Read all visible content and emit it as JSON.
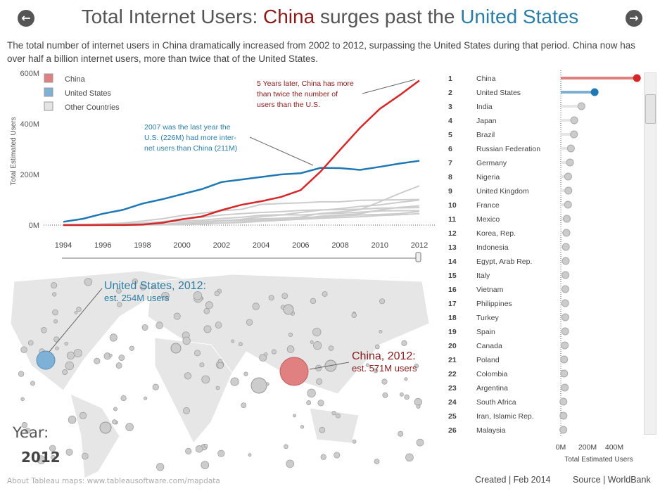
{
  "header": {
    "title_prefix": "Total Internet Users: ",
    "title_china": "China",
    "title_mid": " surges past the ",
    "title_us": "United States",
    "back_icon": "arrow-left-icon",
    "forward_icon": "arrow-right-icon"
  },
  "description": "The total number of internet users in China dramatically increased from 2002 to 2012, surpassing the United States during that period. China now has over half a billion internet users, more than twice that of the United States.",
  "colors": {
    "china": "#d62728",
    "china_light": "#e08080",
    "us": "#1f77b4",
    "us_light": "#7fb0d6",
    "other": "#cccccc",
    "us_text": "#2a7ea6",
    "china_text": "#8b1a1a"
  },
  "chart_data": [
    {
      "type": "line",
      "ylabel": "Total Estimated Users",
      "ylim": [
        0,
        600
      ],
      "y_unit": "M",
      "yticks": [
        "0M",
        "200M",
        "400M",
        "600M"
      ],
      "x": [
        1994,
        1995,
        1996,
        1997,
        1998,
        1999,
        2000,
        2001,
        2002,
        2003,
        2004,
        2005,
        2006,
        2007,
        2008,
        2009,
        2010,
        2011,
        2012
      ],
      "xticks": [
        "1994",
        "1996",
        "1998",
        "2000",
        "2002",
        "2004",
        "2006",
        "2008",
        "2010",
        "2012"
      ],
      "legend": [
        "China",
        "United States",
        "Other Countries"
      ],
      "legend_position": "top-left",
      "series": [
        {
          "name": "China",
          "values": [
            0,
            0,
            0.2,
            0.4,
            2,
            9,
            23,
            34,
            59,
            80,
            94,
            111,
            138,
            211,
            298,
            384,
            459,
            513,
            571
          ]
        },
        {
          "name": "United States",
          "values": [
            13,
            25,
            45,
            60,
            85,
            102,
            122,
            142,
            170,
            180,
            190,
            200,
            205,
            226,
            225,
            218,
            230,
            243,
            254
          ]
        },
        {
          "name": "Other Countries",
          "lines": [
            [
              0,
              0,
              0.1,
              0.3,
              1,
              3,
              5,
              7,
              17,
              18,
              22,
              27,
              32,
              46,
              52,
              61,
              92,
              125,
              155
            ],
            [
              2,
              3,
              5,
              8,
              16,
              25,
              38,
              47,
              57,
              62,
              82,
              85,
              88,
              92,
              92,
              98,
              99,
              100,
              101
            ],
            [
              0,
              0,
              0.2,
              0.5,
              1.5,
              2.5,
              5,
              11,
              16,
              23,
              33,
              40,
              50,
              59,
              65,
              74,
              80,
              90,
              99
            ],
            [
              0,
              0.1,
              0.3,
              0.6,
              1.2,
              2,
              3,
              4,
              9,
              12,
              18,
              22,
              25,
              35,
              40,
              45,
              60,
              70,
              76
            ],
            [
              1,
              2,
              3,
              5,
              8,
              14,
              24,
              31,
              40,
              45,
              50,
              53,
              58,
              60,
              61,
              63,
              67,
              68,
              69
            ],
            [
              1,
              2,
              3,
              5,
              8,
              12,
              16,
              19,
              26,
              31,
              39,
              41,
              40,
              44,
              47,
              51,
              56,
              57,
              57
            ],
            [
              0,
              0.1,
              0.3,
              0.7,
              1.5,
              3,
              9,
              14,
              18,
              21,
              25,
              27,
              30,
              32,
              36,
              40,
              42,
              45,
              54
            ],
            [
              0,
              0,
              0.1,
              0.2,
              0.5,
              1,
              2,
              5,
              8,
              10,
              15,
              19,
              23,
              27,
              30,
              33,
              38,
              41,
              45
            ]
          ]
        }
      ],
      "annotations": [
        "5 Years later, China has more",
        "than twice the number of",
        "users than the U.S.",
        "2007 was the last year the",
        "U.S. (226M) had more inter-",
        "net users than China (211M)"
      ]
    },
    {
      "type": "bar",
      "xlabel": "Total Estimated Users",
      "xticks": [
        "0M",
        "200M",
        "400M"
      ],
      "xlim": [
        0,
        600
      ],
      "categories": [
        "China",
        "United States",
        "India",
        "Japan",
        "Brazil",
        "Russian Federation",
        "Germany",
        "Nigeria",
        "United Kingdom",
        "France",
        "Mexico",
        "Korea, Rep.",
        "Indonesia",
        "Egypt, Arab Rep.",
        "Italy",
        "Vietnam",
        "Philippines",
        "Turkey",
        "Spain",
        "Canada",
        "Poland",
        "Colombia",
        "Argentina",
        "South Africa",
        "Iran, Islamic Rep.",
        "Malaysia"
      ],
      "ranks": [
        "1",
        "2",
        "3",
        "4",
        "5",
        "6",
        "7",
        "8",
        "9",
        "10",
        "11",
        "12",
        "13",
        "14",
        "15",
        "16",
        "17",
        "18",
        "19",
        "20",
        "21",
        "22",
        "23",
        "24",
        "25",
        "26"
      ],
      "values": [
        571,
        254,
        155,
        101,
        99,
        76,
        69,
        55,
        57,
        54,
        45,
        42,
        38,
        37,
        35,
        34,
        33,
        34,
        33,
        30,
        25,
        25,
        30,
        20,
        20,
        19
      ]
    }
  ],
  "map": {
    "us_label": "United States, 2012:",
    "us_value": "est. 254M users",
    "china_label": "China, 2012:",
    "china_value": "est. 571M users",
    "year_label": "Year:",
    "year_value": "2012",
    "attribution": "About Tableau maps: www.tableausoftware.com/mapdata"
  },
  "footer": {
    "created": "Created | Feb 2014",
    "source": "Source | WorldBank"
  }
}
